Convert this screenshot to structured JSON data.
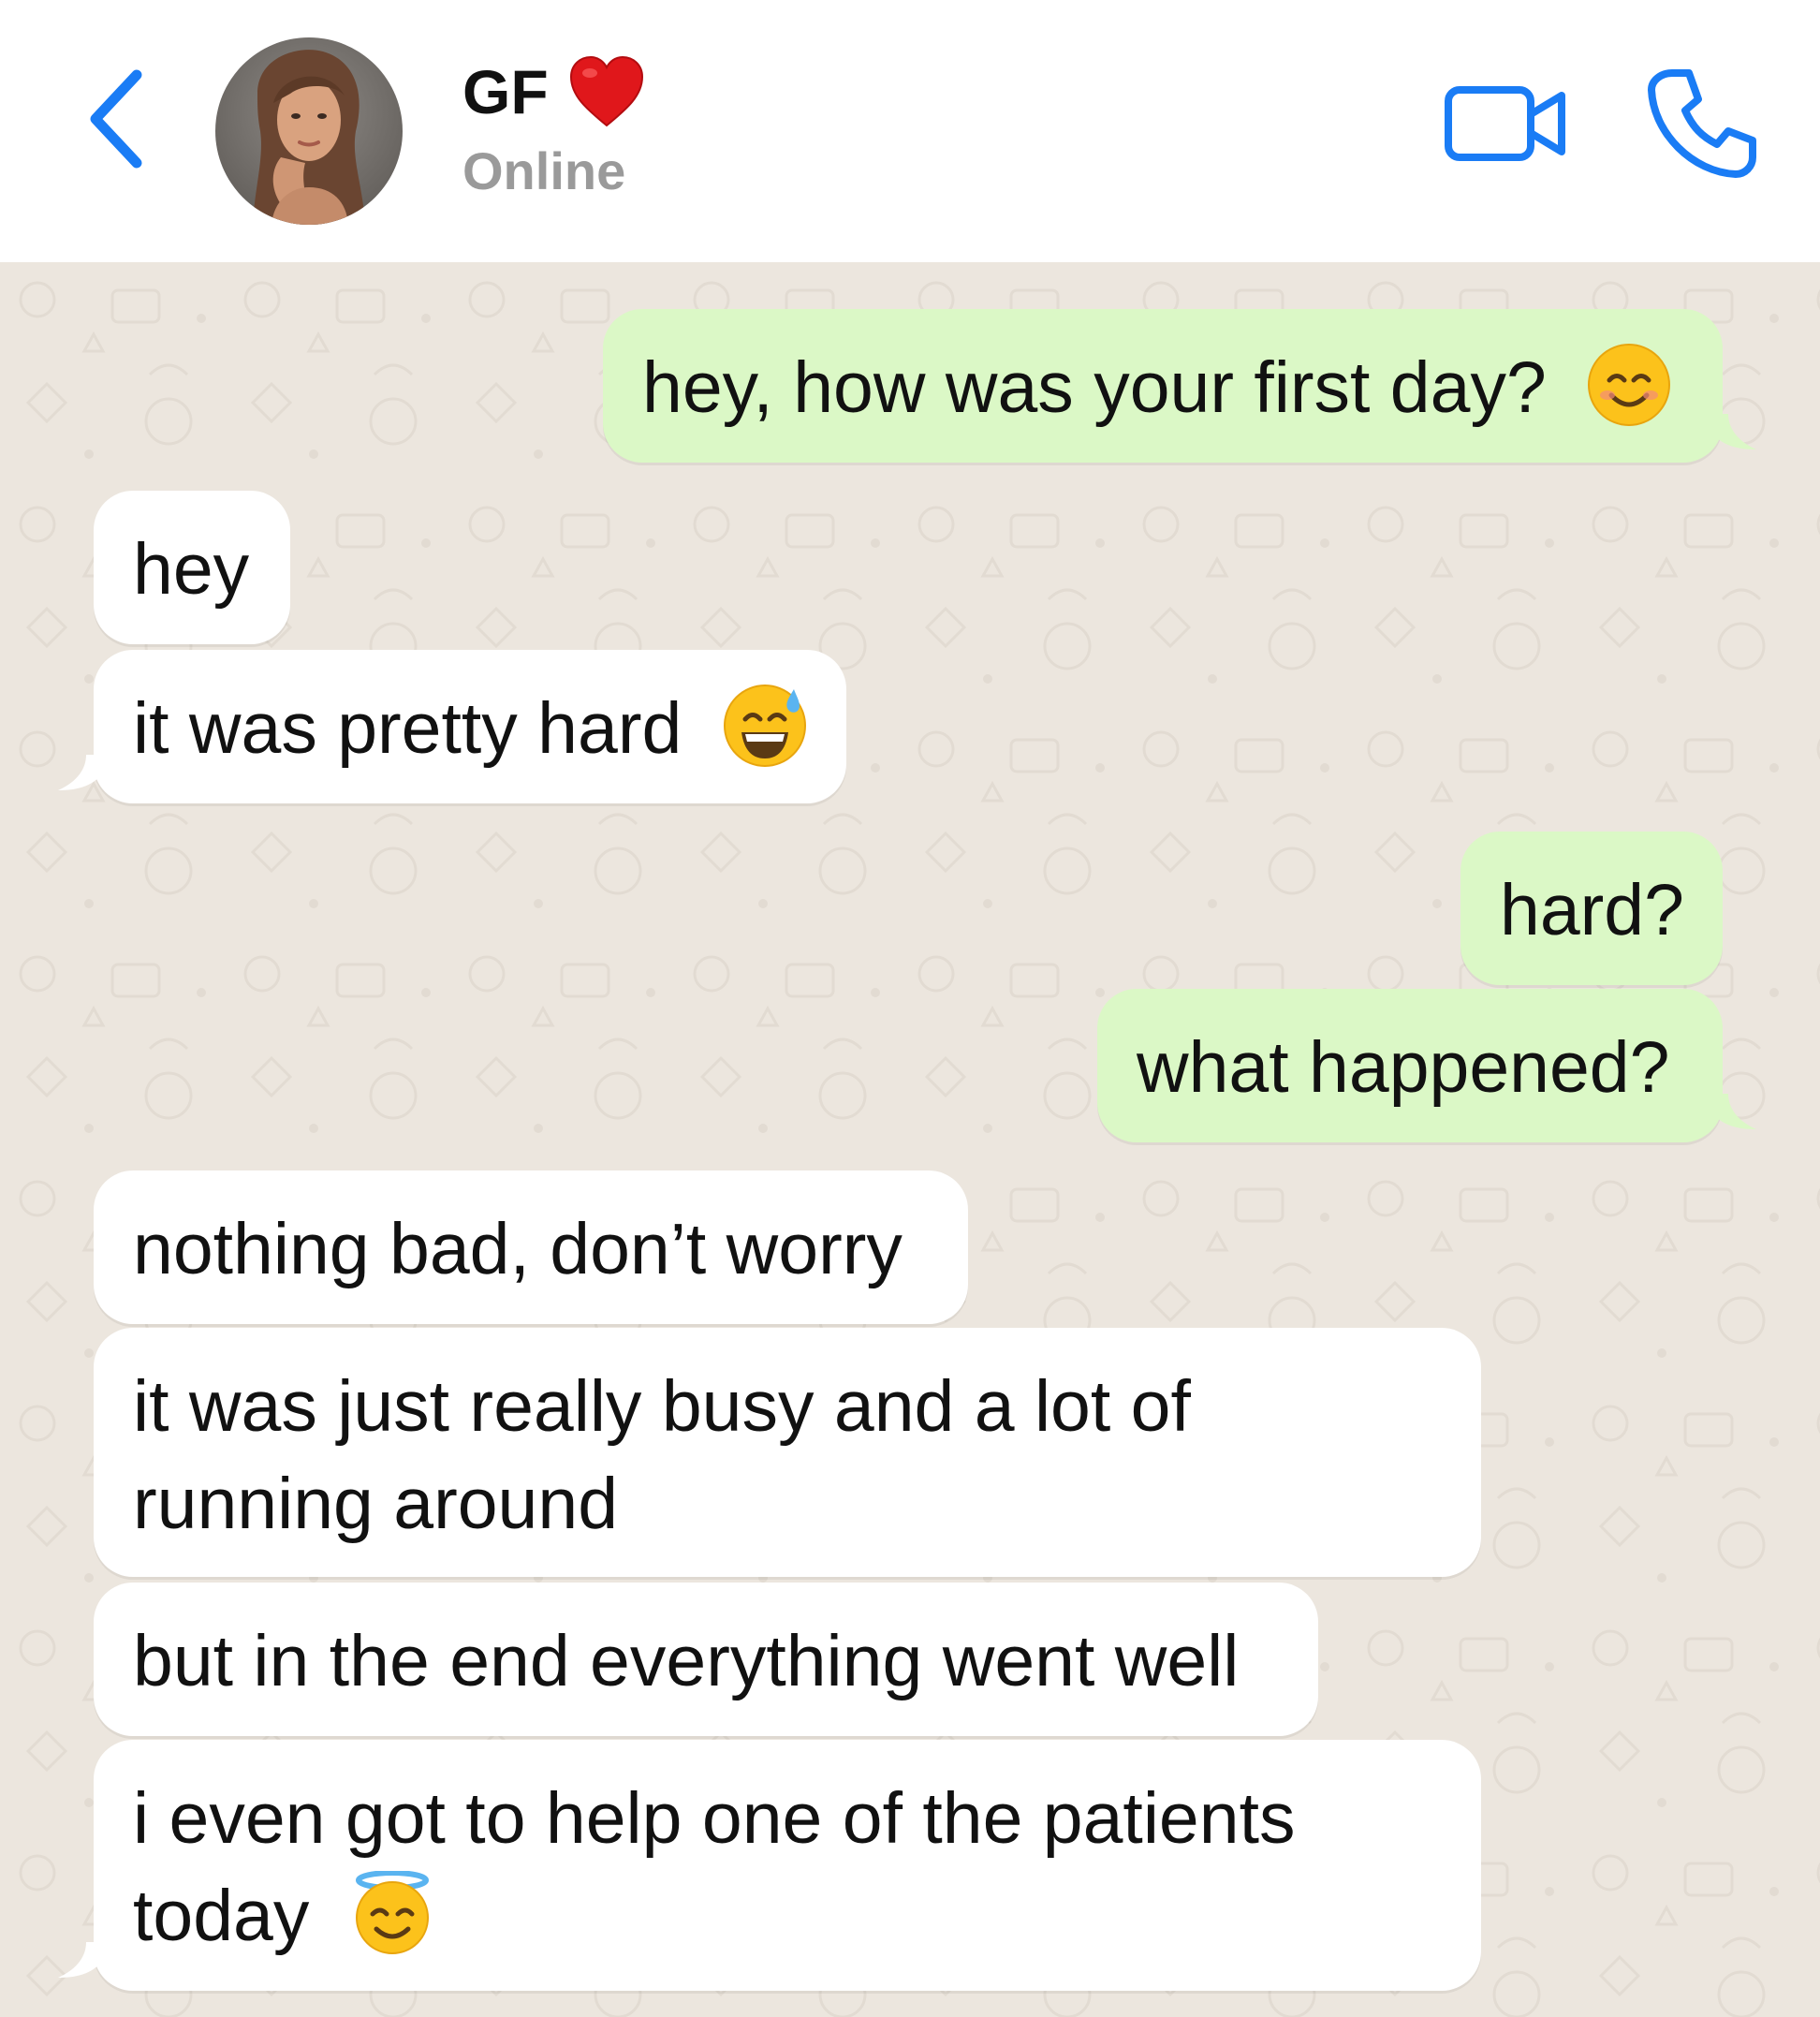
{
  "header": {
    "contact_name": "GF",
    "status": "Online",
    "colors": {
      "accent": "#1a7cf5",
      "status": "#9a9a9a"
    }
  },
  "icons": [
    "back-chevron-icon",
    "avatar-photo",
    "red-heart-icon",
    "video-camera-icon",
    "phone-icon"
  ],
  "chat": {
    "background_color": "#ece6de",
    "outgoing_color": "#dbf8c6",
    "incoming_color": "#ffffff",
    "messages": [
      {
        "direction": "out",
        "text": "hey, how was your first day?",
        "emoji": "smiling-face-icon"
      },
      {
        "direction": "in",
        "text": "hey"
      },
      {
        "direction": "in",
        "text": "it was pretty hard",
        "emoji": "grinning-sweat-icon"
      },
      {
        "direction": "out",
        "text": "hard?"
      },
      {
        "direction": "out",
        "text": "what happened?"
      },
      {
        "direction": "in",
        "text": "nothing bad, don’t worry"
      },
      {
        "direction": "in",
        "text": "it was just really busy and a lot of running around"
      },
      {
        "direction": "in",
        "text": "but in the end everything went well"
      },
      {
        "direction": "in",
        "text": "i even got to help one of the patients today",
        "emoji": "halo-face-icon"
      }
    ]
  }
}
